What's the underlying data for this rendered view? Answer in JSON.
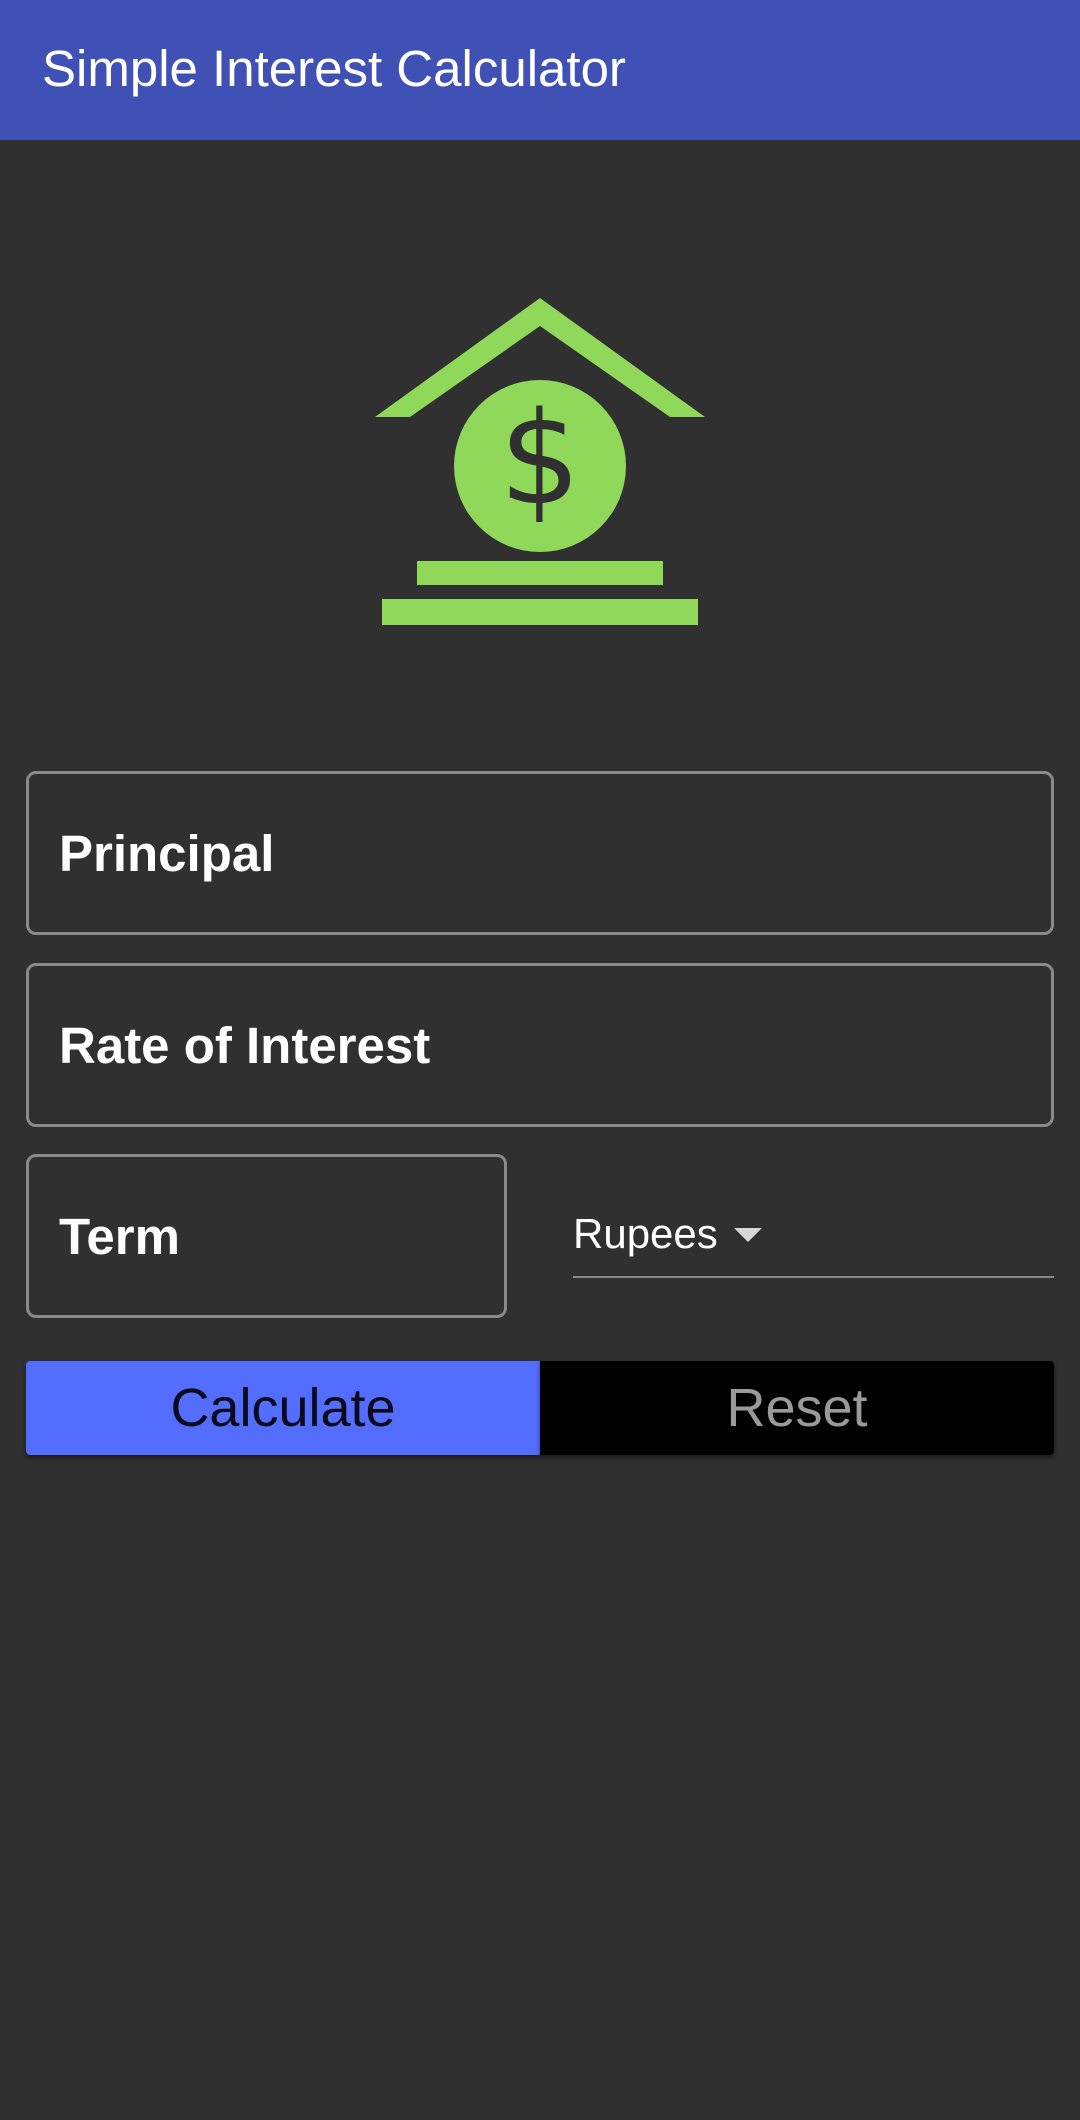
{
  "app_bar": {
    "title": "Simple Interest Calculator",
    "color": "#3F51B5"
  },
  "logo": {
    "icon": "bank-dollar-icon",
    "color": "#8FD85A"
  },
  "form": {
    "principal": {
      "placeholder": "Principal",
      "value": ""
    },
    "rate": {
      "placeholder": "Rate of Interest",
      "value": ""
    },
    "term": {
      "placeholder": "Term",
      "value": ""
    },
    "currency": {
      "selected": "Rupees"
    }
  },
  "actions": {
    "calculate_label": "Calculate",
    "calculate_color": "#536DFE",
    "reset_label": "Reset",
    "reset_color": "#000000"
  },
  "theme": {
    "background": "#303030"
  }
}
